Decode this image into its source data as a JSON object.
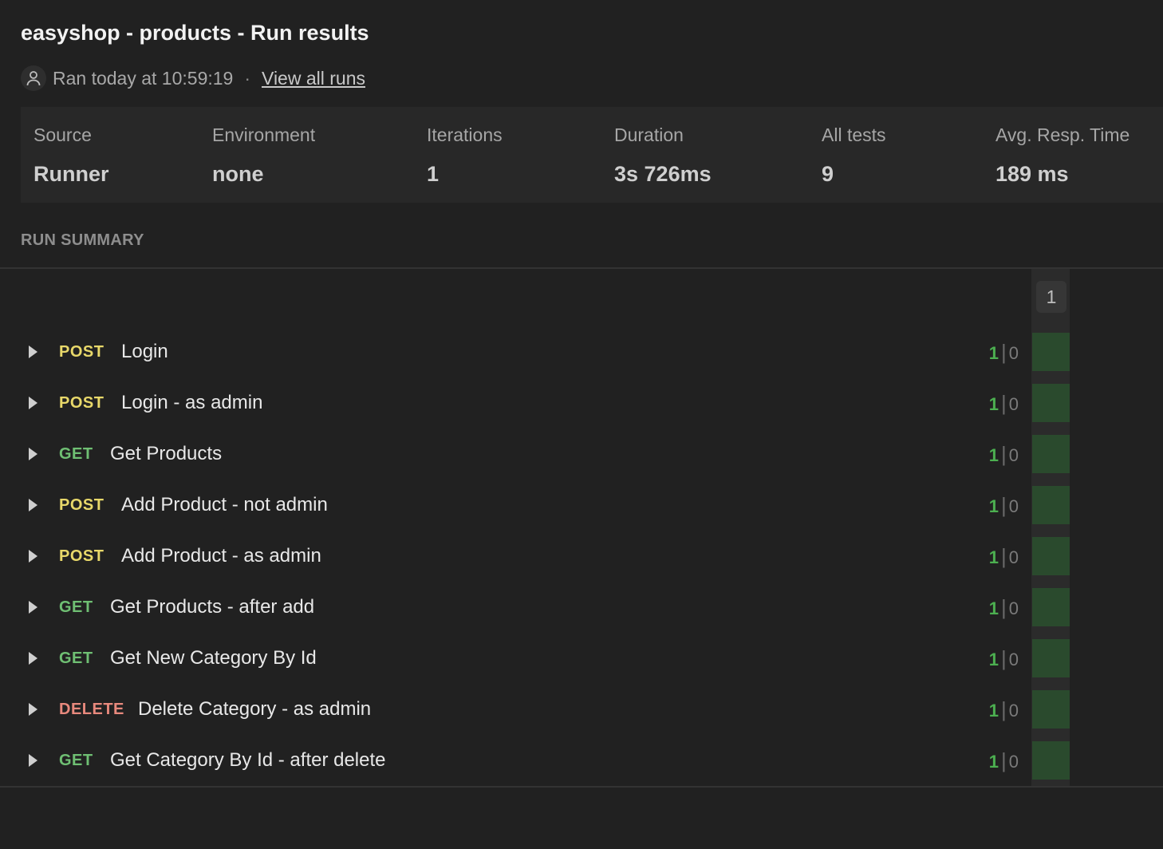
{
  "title": "easyshop - products - Run results",
  "meta": {
    "ran_text": "Ran today at 10:59:19",
    "separator": "·",
    "view_all_runs": "View all runs"
  },
  "stats": [
    {
      "label": "Source",
      "value": "Runner"
    },
    {
      "label": "Environment",
      "value": "none"
    },
    {
      "label": "Iterations",
      "value": "1"
    },
    {
      "label": "Duration",
      "value": "3s 726ms"
    },
    {
      "label": "All tests",
      "value": "9"
    },
    {
      "label": "Avg. Resp. Time",
      "value": "189 ms"
    }
  ],
  "run_summary": {
    "title": "RUN SUMMARY",
    "iteration_label": "1",
    "requests": [
      {
        "method": "POST",
        "name": "Login",
        "passed": "1",
        "failed": "0"
      },
      {
        "method": "POST",
        "name": "Login - as admin",
        "passed": "1",
        "failed": "0"
      },
      {
        "method": "GET",
        "name": "Get Products",
        "passed": "1",
        "failed": "0"
      },
      {
        "method": "POST",
        "name": "Add Product - not admin",
        "passed": "1",
        "failed": "0"
      },
      {
        "method": "POST",
        "name": "Add Product - as admin",
        "passed": "1",
        "failed": "0"
      },
      {
        "method": "GET",
        "name": "Get Products - after add",
        "passed": "1",
        "failed": "0"
      },
      {
        "method": "GET",
        "name": "Get New Category By Id",
        "passed": "1",
        "failed": "0"
      },
      {
        "method": "DELETE",
        "name": "Delete Category - as admin",
        "passed": "1",
        "failed": "0"
      },
      {
        "method": "GET",
        "name": "Get Category By Id - after delete",
        "passed": "1",
        "failed": "0"
      }
    ]
  },
  "colors": {
    "POST": "#e8d86a",
    "GET": "#6fbf73",
    "DELETE": "#e8897d",
    "pass_cell": "#2a4a2d"
  }
}
